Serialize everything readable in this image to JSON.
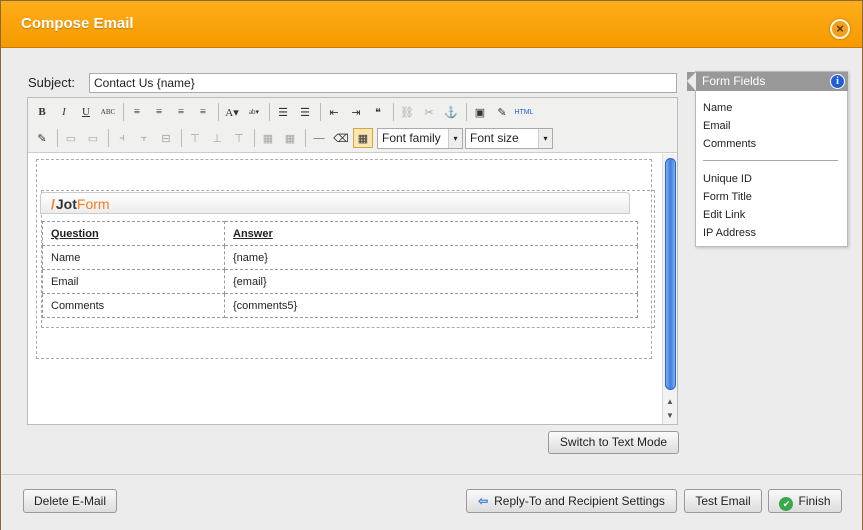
{
  "window": {
    "title": "Compose Email",
    "close_icon": "×"
  },
  "subject": {
    "label": "Subject:",
    "value": "Contact Us {name}"
  },
  "toolbar": {
    "row1": [
      {
        "name": "bold-icon",
        "glyph": "B"
      },
      {
        "name": "italic-icon",
        "glyph": "I"
      },
      {
        "name": "underline-icon",
        "glyph": "U"
      },
      {
        "name": "strikethrough-icon",
        "glyph": "ABC"
      },
      {
        "name": "align-left-icon",
        "glyph": "≡"
      },
      {
        "name": "align-center-icon",
        "glyph": "≡"
      },
      {
        "name": "align-right-icon",
        "glyph": "≡"
      },
      {
        "name": "align-justify-icon",
        "glyph": "≡"
      },
      {
        "name": "text-color-icon",
        "glyph": "A▾"
      },
      {
        "name": "highlight-color-icon",
        "glyph": "ab▾"
      },
      {
        "name": "bullet-list-icon",
        "glyph": "☰"
      },
      {
        "name": "numbered-list-icon",
        "glyph": "☰"
      },
      {
        "name": "outdent-icon",
        "glyph": "⇤"
      },
      {
        "name": "indent-icon",
        "glyph": "⇥"
      },
      {
        "name": "blockquote-icon",
        "glyph": "❝"
      },
      {
        "name": "link-icon",
        "glyph": "⛓"
      },
      {
        "name": "unlink-icon",
        "glyph": "✂"
      },
      {
        "name": "anchor-icon",
        "glyph": "⚓"
      },
      {
        "name": "image-icon",
        "glyph": "▣"
      },
      {
        "name": "cleanup-icon",
        "glyph": "✎"
      },
      {
        "name": "html-icon",
        "glyph": "HTML"
      }
    ],
    "row2": [
      {
        "name": "edit-icon",
        "glyph": "✎"
      },
      {
        "name": "table-row-icon",
        "glyph": "▭"
      },
      {
        "name": "table-row-2-icon",
        "glyph": "▭"
      },
      {
        "name": "insert-col-before-icon",
        "glyph": "⫞"
      },
      {
        "name": "insert-col-after-icon",
        "glyph": "⫟"
      },
      {
        "name": "delete-col-icon",
        "glyph": "⊟"
      },
      {
        "name": "insert-row-before-icon",
        "glyph": "⊤"
      },
      {
        "name": "insert-row-after-icon",
        "glyph": "⊥"
      },
      {
        "name": "delete-row-icon",
        "glyph": "⊤"
      },
      {
        "name": "merge-cells-icon",
        "glyph": "▦"
      },
      {
        "name": "split-cells-icon",
        "glyph": "▦"
      },
      {
        "name": "horizontal-rule-icon",
        "glyph": "—"
      },
      {
        "name": "eraser-icon",
        "glyph": "⌫"
      },
      {
        "name": "table-icon",
        "glyph": "▦"
      }
    ],
    "font_family": "Font family",
    "font_size": "Font size"
  },
  "email_body": {
    "logo_prefix": "Jot",
    "logo_suffix": "Form",
    "headers": [
      "Question",
      "Answer"
    ],
    "rows": [
      [
        "Name",
        "{name}"
      ],
      [
        "Email",
        "{email}"
      ],
      [
        "Comments",
        "{comments5}"
      ]
    ]
  },
  "switch_mode_label": "Switch to Text Mode",
  "form_fields": {
    "title": "Form Fields",
    "info_icon": "i",
    "fields": [
      "Name",
      "Email",
      "Comments"
    ],
    "meta": [
      "Unique ID",
      "Form Title",
      "Edit Link",
      "IP Address"
    ]
  },
  "footer": {
    "delete_label": "Delete E-Mail",
    "reply_label": "Reply-To and Recipient Settings",
    "test_label": "Test Email",
    "finish_label": "Finish"
  }
}
